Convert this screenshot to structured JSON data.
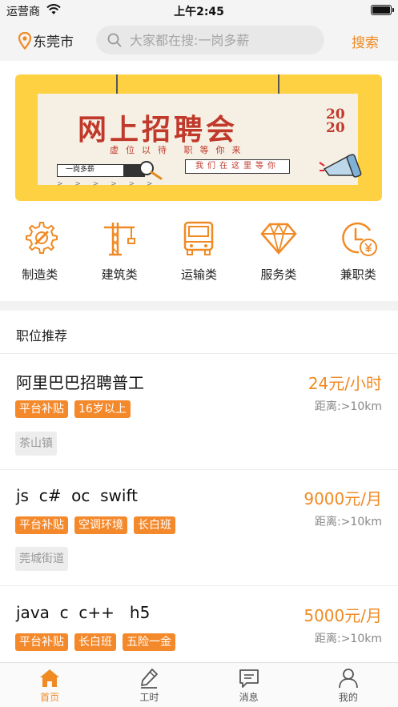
{
  "status_bar": {
    "carrier": "运营商",
    "time": "上午2:45"
  },
  "header": {
    "location": "东莞市",
    "search_placeholder": "大家都在搜:一岗多薪",
    "search_button": "搜索"
  },
  "banner": {
    "title": "网上招聘会",
    "year_top": "20",
    "year_bottom": "20",
    "subtitle": "虚位以待 职等你来",
    "bar_text": "一岗多薪",
    "tag_text": "我们在这里等你",
    "arrows": "> > > > > >"
  },
  "categories": [
    {
      "label": "制造类",
      "icon": "gear-wrench-icon"
    },
    {
      "label": "建筑类",
      "icon": "crane-icon"
    },
    {
      "label": "运输类",
      "icon": "truck-icon"
    },
    {
      "label": "服务类",
      "icon": "diamond-icon"
    },
    {
      "label": "兼职类",
      "icon": "clock-yen-icon"
    }
  ],
  "section": {
    "title": "职位推荐"
  },
  "jobs": [
    {
      "title": "阿里巴巴招聘普工",
      "salary": "24元/小时",
      "distance": "距离:>10km",
      "tags": [
        "平台补贴",
        "16岁以上"
      ],
      "location": "茶山镇"
    },
    {
      "title": "js  c#  oc  swift",
      "salary": "9000元/月",
      "distance": "距离:>10km",
      "tags": [
        "平台补贴",
        "空调环境",
        "长白班"
      ],
      "location": "莞城街道"
    },
    {
      "title": "java  c  c++   h5",
      "salary": "5000元/月",
      "distance": "距离:>10km",
      "tags": [
        "平台补贴",
        "长白班",
        "五险一金"
      ],
      "location": ""
    }
  ],
  "tabbar": [
    {
      "label": "首页",
      "icon": "home-icon",
      "active": true
    },
    {
      "label": "工时",
      "icon": "edit-icon",
      "active": false
    },
    {
      "label": "消息",
      "icon": "message-icon",
      "active": false
    },
    {
      "label": "我的",
      "icon": "user-icon",
      "active": false
    }
  ],
  "colors": {
    "accent": "#f08a24",
    "tag_bg": "#f4892b",
    "banner_bg": "#fdd141",
    "banner_red": "#c0392b"
  }
}
